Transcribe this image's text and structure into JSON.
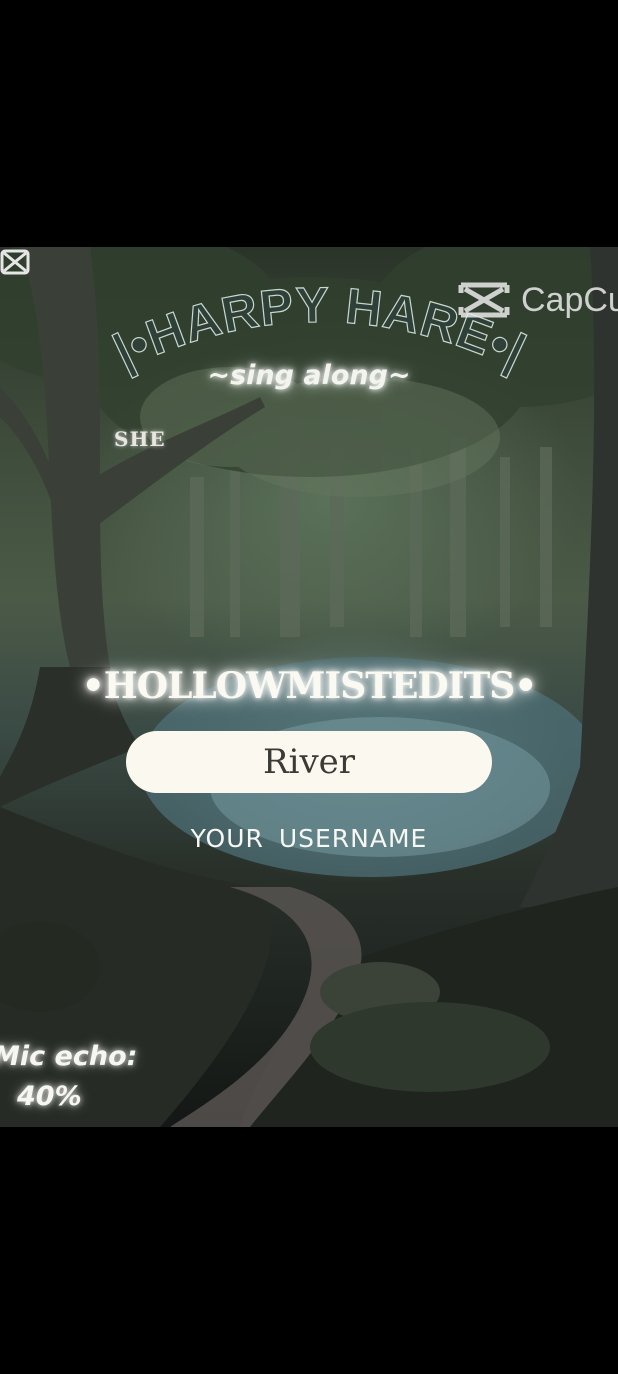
{
  "overlay": {
    "title": "|•HARPY HARE•|",
    "subtitle": "~sing along~",
    "tag": "SHE",
    "brand": "•HOLLOWMISTEDITS•",
    "name_value": "River",
    "name_label": "YOUR USERNAME",
    "mic_echo_label": "Mic echo:",
    "mic_echo_value": "40%"
  },
  "watermark": {
    "text": "CapCut",
    "icon": "capcut-logo-icon"
  },
  "colors": {
    "pill_bg": "#fbf9ef",
    "pill_text": "#3b3a36",
    "glow_text": "#fbfaf2",
    "arc_text": "#2f4039"
  }
}
